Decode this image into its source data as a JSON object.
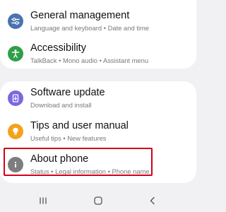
{
  "settings": {
    "items": [
      {
        "title": "General management",
        "subtitle": "Language and keyboard  •  Date and time",
        "icon": "sliders-icon",
        "color": "#4a73b0"
      },
      {
        "title": "Accessibility",
        "subtitle": "TalkBack  •  Mono audio  •  Assistant menu",
        "icon": "accessibility-icon",
        "color": "#2f9e49"
      },
      {
        "title": "Software update",
        "subtitle": "Download and install",
        "icon": "software-update-icon",
        "color": "#7b68e0"
      },
      {
        "title": "Tips and user manual",
        "subtitle": "Useful tips  •  New features",
        "icon": "lightbulb-icon",
        "color": "#f3a21a"
      },
      {
        "title": "About phone",
        "subtitle": "Status  •  Legal information  •  Phone name",
        "icon": "info-icon",
        "color": "#7d7d7d"
      }
    ]
  },
  "highlight_color": "#d0021b",
  "navbar": {
    "buttons": [
      "recent-apps-icon",
      "home-icon",
      "back-icon"
    ]
  }
}
